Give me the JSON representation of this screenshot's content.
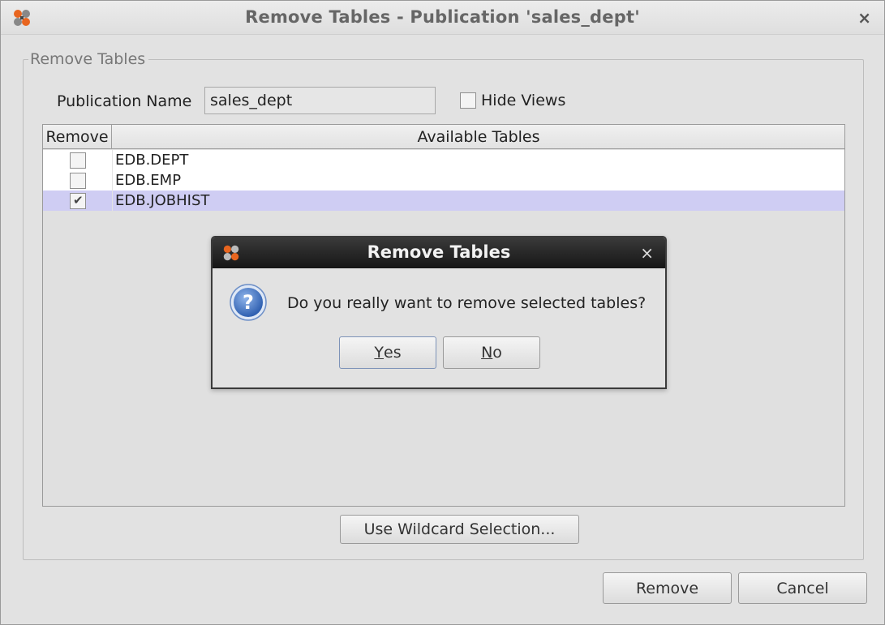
{
  "window": {
    "title": "Remove Tables - Publication 'sales_dept'",
    "close_glyph": "×"
  },
  "group": {
    "legend": "Remove Tables"
  },
  "publication": {
    "label": "Publication Name",
    "value": "sales_dept"
  },
  "hide_views": {
    "label": "Hide Views",
    "checked": false
  },
  "table": {
    "columns": [
      "Remove",
      "Available Tables"
    ],
    "rows": [
      {
        "remove": false,
        "name": "EDB.DEPT"
      },
      {
        "remove": false,
        "name": "EDB.EMP"
      },
      {
        "remove": true,
        "name": "EDB.JOBHIST",
        "selected": true
      }
    ]
  },
  "buttons": {
    "wildcard": "Use Wildcard Selection...",
    "remove": "Remove",
    "cancel": "Cancel"
  },
  "dialog": {
    "title": "Remove Tables",
    "close_glyph": "×",
    "message": "Do you really want to remove selected tables?",
    "yes_mnemonic": "Y",
    "yes_rest": "es",
    "no_mnemonic": "N",
    "no_rest": "o"
  },
  "colors": {
    "selected_row": "#cfcdf3",
    "modal_titlebar": "#1f1f1f",
    "app_icon_orange": "#e8651f"
  },
  "icons": {
    "app": "app-logo-icon",
    "question": "question-icon"
  }
}
